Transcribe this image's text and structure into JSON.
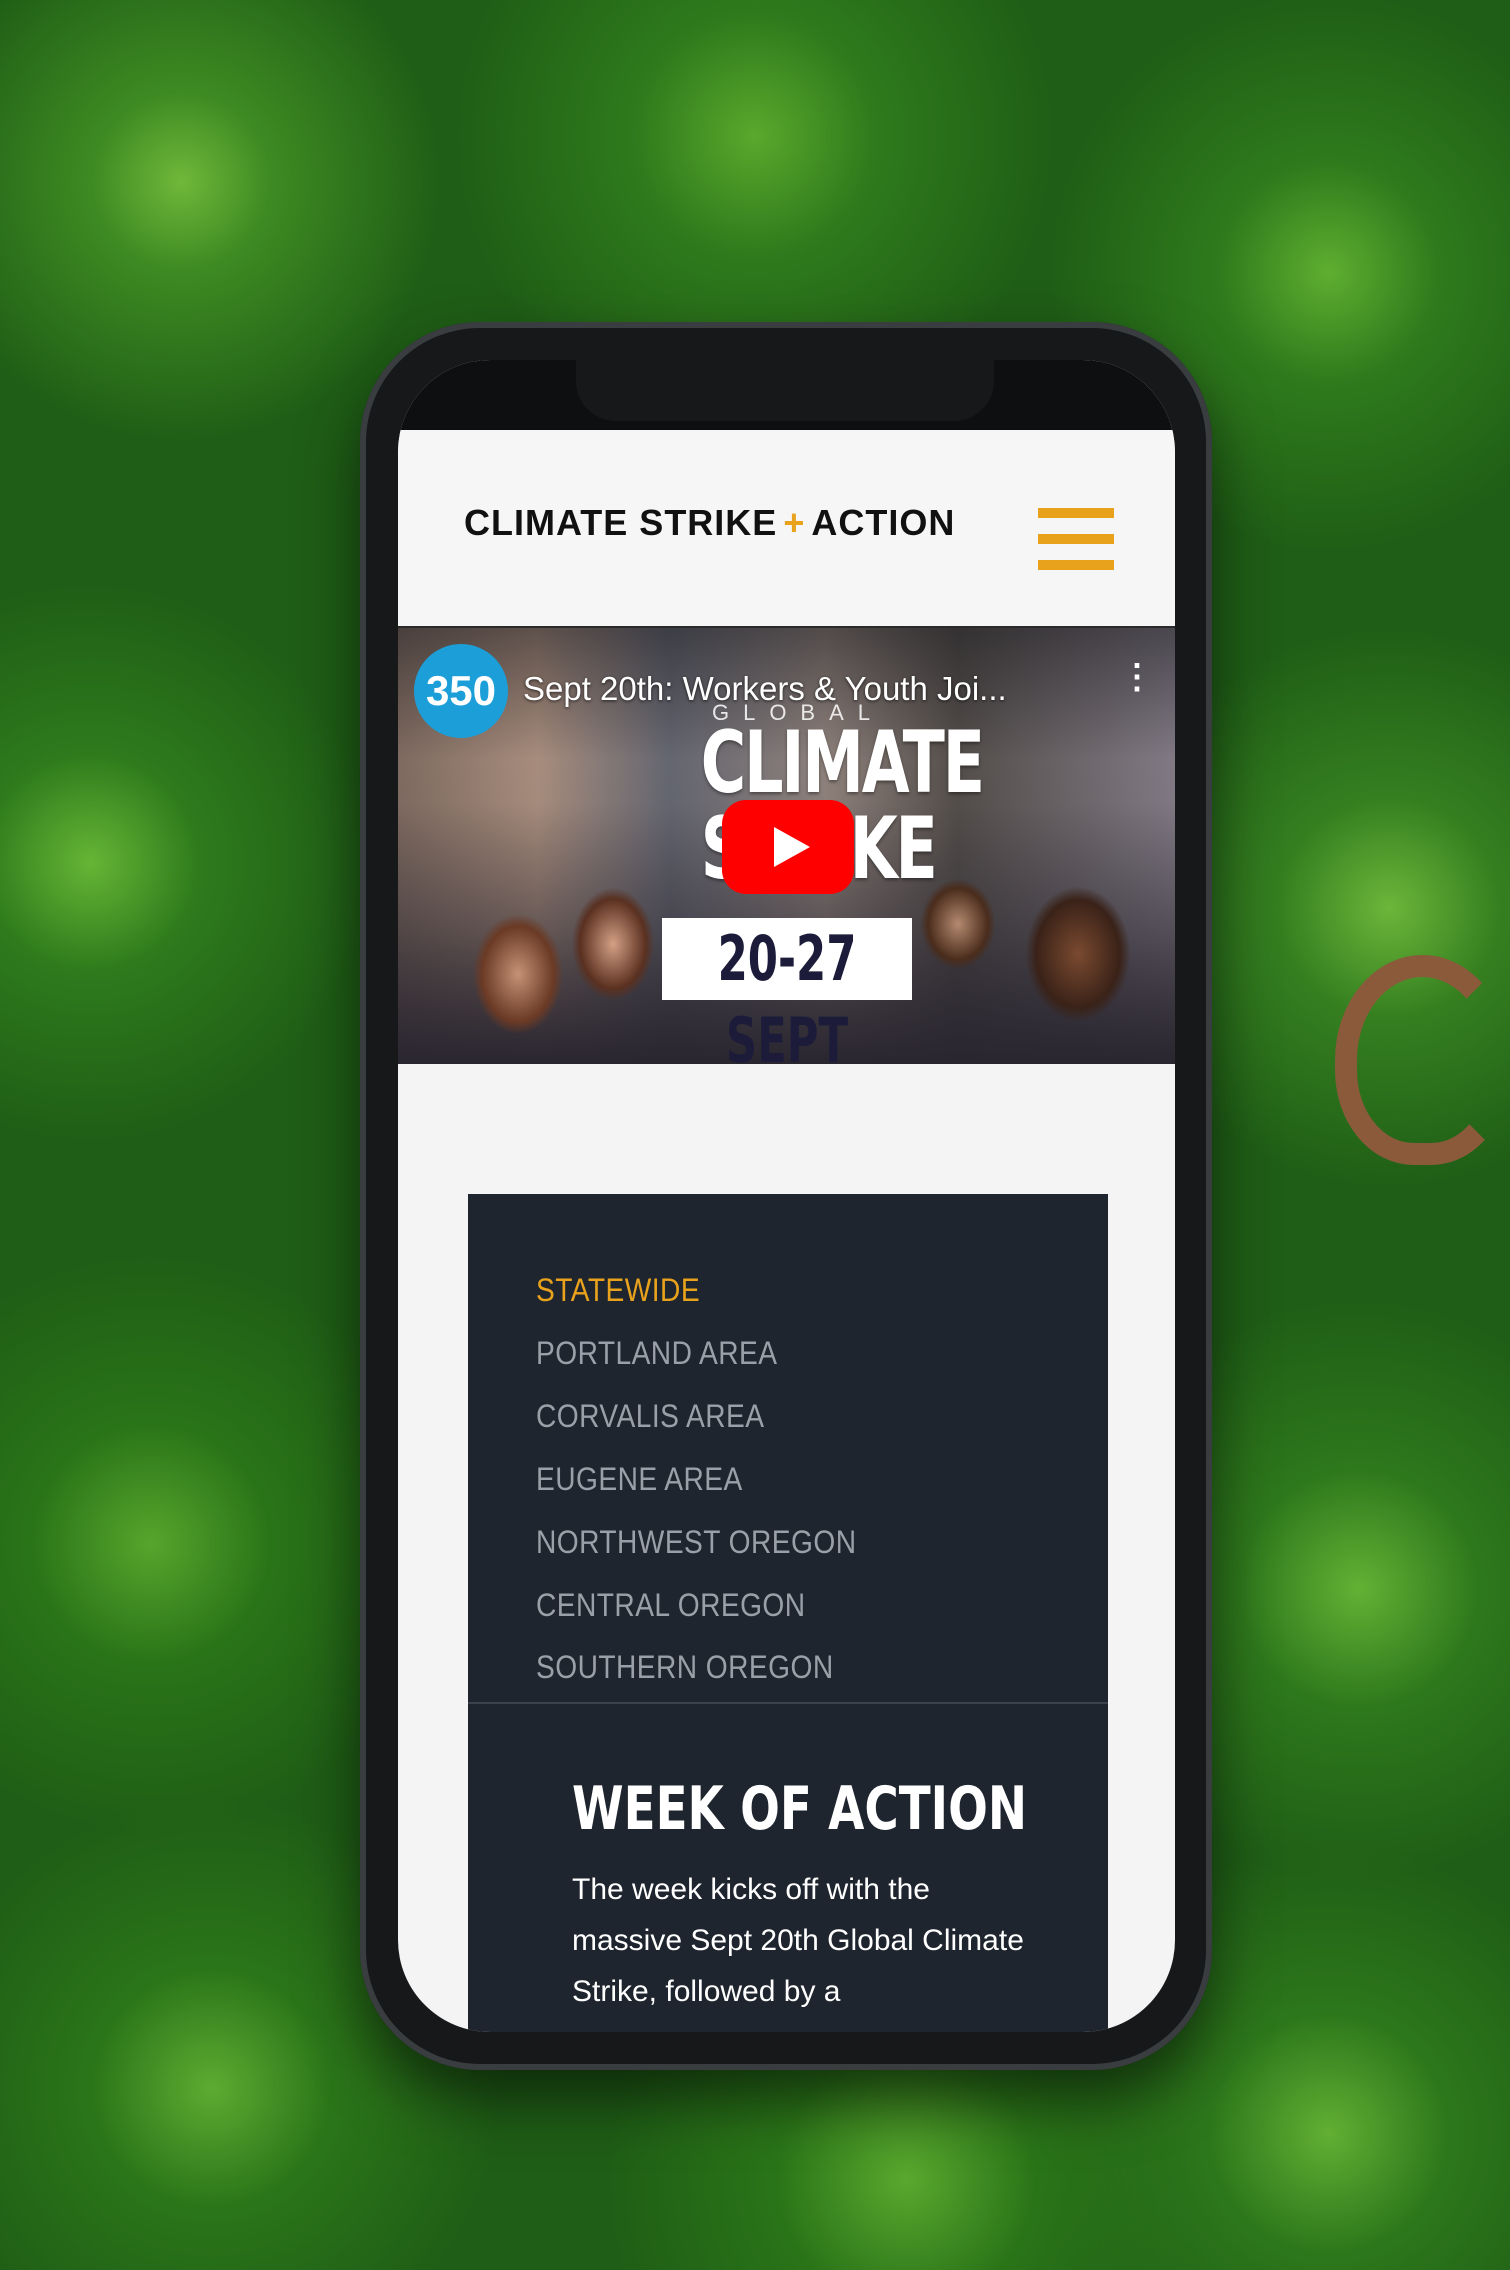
{
  "header": {
    "logo_left": "CLIMATE STRIKE",
    "logo_plus": "+",
    "logo_right": "ACTION",
    "menu_icon": "hamburger-icon",
    "accent_color": "#e8a21c"
  },
  "video": {
    "channel_logo": "350",
    "title": "Sept 20th: Workers & Youth Joi...",
    "more_icon": "⋮",
    "poster_global": "GLOBAL",
    "poster_title": "CLIMATE STRIKE",
    "poster_dates": "20-27 SEPT",
    "play_icon": "youtube-play-icon"
  },
  "regions": {
    "items": [
      {
        "label": "STATEWIDE",
        "active": true
      },
      {
        "label": "PORTLAND AREA",
        "active": false
      },
      {
        "label": "CORVALIS AREA",
        "active": false
      },
      {
        "label": "EUGENE AREA",
        "active": false
      },
      {
        "label": "NORTHWEST OREGON",
        "active": false
      },
      {
        "label": "CENTRAL OREGON",
        "active": false
      },
      {
        "label": "SOUTHERN OREGON",
        "active": false
      }
    ]
  },
  "section": {
    "title": "WEEK OF ACTION",
    "body": "The week kicks off with the massive Sept 20th Global Climate Strike, followed by a"
  }
}
